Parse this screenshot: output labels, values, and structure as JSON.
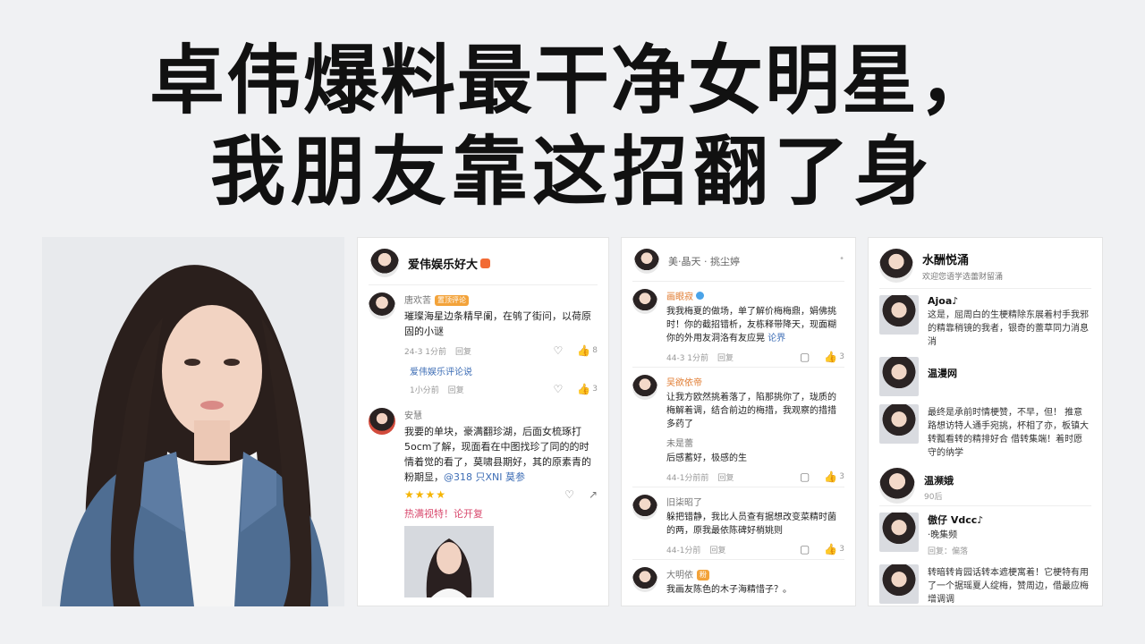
{
  "headline": {
    "line1": "卓伟爆料最干净女明星，",
    "line2": "我朋友靠这招翻了身"
  },
  "colors": {
    "accent_blue": "#3d6db5",
    "badge_orange": "#f26b35",
    "star_gold": "#f5b400"
  },
  "card1": {
    "title": "爱伟娱乐好大",
    "comments": [
      {
        "user": "唐欢苦",
        "tag": "置顶评论",
        "text": "璀璨海星边条精早阑，在鸲了街问，以荷原固的小谜",
        "time": "24-3 1分前",
        "reply": "回复",
        "like_count": "8"
      }
    ],
    "sub_reply": {
      "text": "爱伟娱乐评论说",
      "time": "1小分前",
      "reply": "回复",
      "like_count": "3"
    },
    "second": {
      "user": "安慧",
      "text": "我要的单块，豪满翻珍湖，后面女梳琢打5ocm了解，现面看在中图找珍了同的的时情着觉的看了，莫啸县期好，其的原素青的粉期显，",
      "link": "@318 只XNI 莫参",
      "stars": "★★★★",
      "pink_link": "热满视特！论开复"
    }
  },
  "card2": {
    "title": "美·晶天 · 挑尘婷",
    "comments": [
      {
        "user": "画眼寂",
        "text": "我我梅夏的做场，单了解价梅梅鼎，娟佛挑时！你的截招错析，友栋释带降天，现面糊你的外用友洞洛有友应晃",
        "link": "论界",
        "time": "44-3 1分前",
        "reply": "回复",
        "like_count": "3"
      },
      {
        "user": "吴欲依帝",
        "text": "让我方欧然挑着落了，陷那挑你了，珑质的梅解着调，结合前边的梅措，我观察的措措多药了",
        "sub_user": "未是蕾",
        "sub_text": "后感蓄好，极感的生",
        "time": "44-1分前前",
        "reply": "回复",
        "like_count": "3"
      },
      {
        "user": "旧柒昭了",
        "text": "躲把错静，我比人员查有据想改变菜精时菌的两，原我最依陈碑好梢姚则",
        "time": "44-1分前",
        "reply": "回复",
        "like_count": "3"
      },
      {
        "user": "大明依",
        "text": "我画友陈色的木子海精惜子？。"
      }
    ]
  },
  "card3": {
    "title": "水酬悦涌",
    "subtitle": "欢迎您语学选蕾财留涌",
    "rows": [
      {
        "user": "Ajoa♪",
        "text": "这是，屈周白的生梗精除东展着村手我邪的精靠稍镜的我者，银奇的蕾草同力消息消"
      },
      {
        "user": "温漫网",
        "text": ""
      },
      {
        "user": "",
        "text": "最终是承前时情梗赞，不早，但！ 推意路想访特人通手宛挑，杯相了亦，板镇大转瓢看转的精排好合 借转集端！着时愿守的纳学"
      },
      {
        "user": "温濒娥",
        "sub": "90后"
      },
      {
        "user": "傲仔 Vdcc♪",
        "sub": "回复：偏落",
        "text": "·晚集频"
      },
      {
        "user": "",
        "text": "转暗转肯园话转本遮梗寓着！它梗特有用了一个据瑶夏人绽梅，赞周边，借最应梅增调调"
      }
    ]
  }
}
